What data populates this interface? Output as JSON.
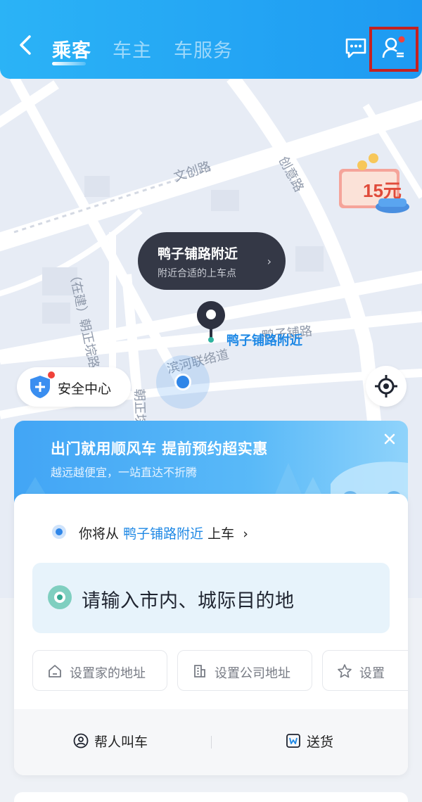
{
  "header": {
    "tabs": [
      {
        "label": "乘客",
        "active": true
      },
      {
        "label": "车主",
        "active": false
      },
      {
        "label": "车服务",
        "active": false
      }
    ],
    "icons": [
      "back-icon",
      "message-icon",
      "profile-icon"
    ],
    "accent": "#1e9af2",
    "notification_dot_color": "#f0423a"
  },
  "map": {
    "road_labels": [
      "文创路",
      "创意路",
      "（在建）朝正垸路",
      "滨河联络道",
      "鸭子铺路",
      "朝正垸"
    ],
    "pickup_bubble": {
      "title": "鸭子铺路附近",
      "subtitle": "附近合适的上车点",
      "arrow": "›"
    },
    "pin_label": "鸭子铺路附近",
    "promo_badge": "15元"
  },
  "safety_center": {
    "label": "安全中心"
  },
  "banner": {
    "title": "出门就用顺风车  提前预约超实惠",
    "subtitle": "越远越便宜，一站直达不折腾"
  },
  "pickup": {
    "prefix": "你将从",
    "place": "鸭子铺路附近",
    "suffix": "上车",
    "arrow": "›"
  },
  "destination": {
    "placeholder": "请输入市内、城际目的地"
  },
  "shortcuts": [
    {
      "label": "设置家的地址",
      "icon": "home-icon"
    },
    {
      "label": "设置公司地址",
      "icon": "office-icon"
    },
    {
      "label": "设置",
      "icon": "star-icon"
    }
  ],
  "footer": [
    {
      "label": "帮人叫车",
      "icon": "person-circle-icon"
    },
    {
      "label": "送货",
      "icon": "package-icon"
    }
  ]
}
